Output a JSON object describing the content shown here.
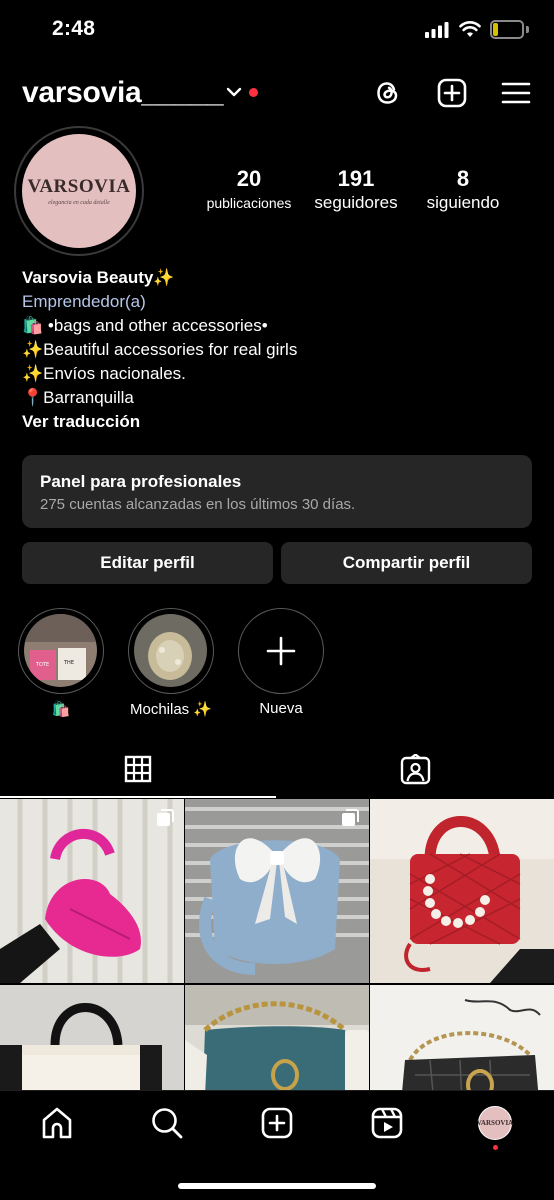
{
  "status_bar": {
    "time": "2:48",
    "battery": "17",
    "battery_level": 0.17,
    "icons": [
      "signal-icon",
      "wifi-icon",
      "battery-icon"
    ]
  },
  "header": {
    "username": "varsovia_____",
    "icons": [
      "chevron-down-icon",
      "threads-icon",
      "add-post-icon",
      "menu-icon"
    ],
    "notification_color": "#ff3040"
  },
  "profile": {
    "avatar_logo": "VARSOVIA",
    "avatar_tagline": "elegancia en cada detalle",
    "avatar_color": "#e4bfc0",
    "stats": [
      {
        "value": "20",
        "label": "publicaciones"
      },
      {
        "value": "191",
        "label": "seguidores"
      },
      {
        "value": "8",
        "label": "siguiendo"
      }
    ],
    "bio": {
      "name": "Varsovia Beauty✨",
      "category": "Emprendedor(a)",
      "lines": [
        "🛍️ •bags and other accessories•",
        "✨Beautiful accessories for real girls",
        "✨Envíos nacionales.",
        "📍Barranquilla"
      ],
      "translate_link": "Ver traducción"
    }
  },
  "dashboard": {
    "title": "Panel para profesionales",
    "subtitle": "275 cuentas alcanzadas en los últimos 30 días."
  },
  "actions": {
    "edit_label": "Editar perfil",
    "share_label": "Compartir perfil"
  },
  "highlights": [
    {
      "label": "🛍️",
      "ring_color": "#5a5a5a"
    },
    {
      "label": "Mochilas ✨",
      "ring_color": "#5a5a5a"
    },
    {
      "label": "Nueva",
      "ring_color": "#5a5a5a"
    }
  ],
  "tabs": [
    {
      "name": "grid-icon",
      "active": true
    },
    {
      "name": "tagged-icon",
      "active": false
    }
  ],
  "posts": [
    {
      "name": "pink-ruched-bag",
      "multiple": true
    },
    {
      "name": "blue-bow-bag",
      "multiple": true
    },
    {
      "name": "red-pearl-handbag",
      "multiple": false
    },
    {
      "name": "beige-tote-bag",
      "multiple": false
    },
    {
      "name": "teal-chain-bag",
      "multiple": false
    },
    {
      "name": "black-snake-bag",
      "multiple": false
    }
  ],
  "bottom_nav": {
    "items": [
      "home-icon",
      "search-icon",
      "create-icon",
      "reels-icon",
      "profile-avatar"
    ],
    "avatar_logo": "VARSOVIA"
  }
}
